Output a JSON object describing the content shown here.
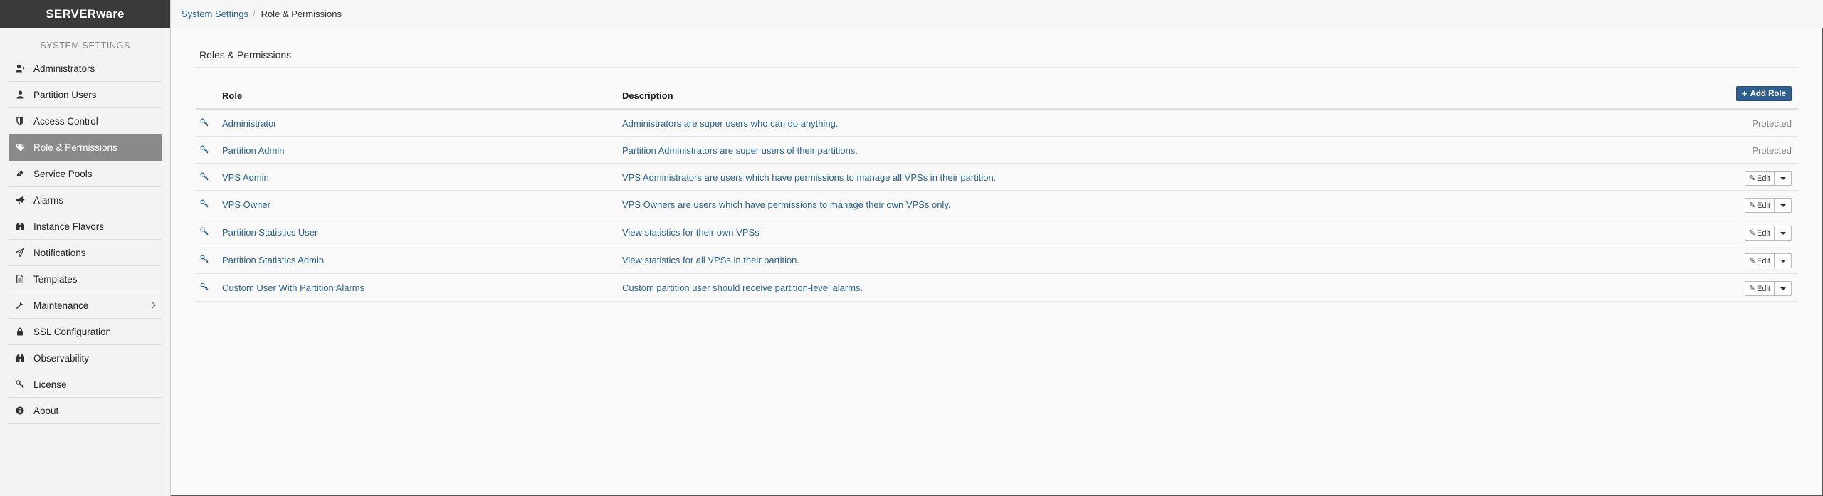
{
  "app": {
    "brand": "SERVERware"
  },
  "sidebar": {
    "section_label": "SYSTEM SETTINGS",
    "items": [
      {
        "label": "Administrators",
        "icon": "user-plus-icon"
      },
      {
        "label": "Partition Users",
        "icon": "user-icon"
      },
      {
        "label": "Access Control",
        "icon": "shield-icon"
      },
      {
        "label": "Role & Permissions",
        "icon": "tags-icon",
        "active": true
      },
      {
        "label": "Service Pools",
        "icon": "pills-icon"
      },
      {
        "label": "Alarms",
        "icon": "bullhorn-icon"
      },
      {
        "label": "Instance Flavors",
        "icon": "binoculars-icon"
      },
      {
        "label": "Notifications",
        "icon": "paper-plane-icon"
      },
      {
        "label": "Templates",
        "icon": "file-text-icon"
      },
      {
        "label": "Maintenance",
        "icon": "wrench-icon",
        "has_submenu": true
      },
      {
        "label": "SSL Configuration",
        "icon": "lock-icon"
      },
      {
        "label": "Observability",
        "icon": "binoculars-icon"
      },
      {
        "label": "License",
        "icon": "key-icon"
      },
      {
        "label": "About",
        "icon": "info-circle-icon"
      }
    ]
  },
  "breadcrumb": {
    "parent": "System Settings",
    "separator": "/",
    "current": "Role & Permissions"
  },
  "main": {
    "title": "Roles & Permissions",
    "add_role_label": "Add Role",
    "columns": {
      "role": "Role",
      "description": "Description"
    },
    "rows": [
      {
        "role": "Administrator",
        "description": "Administrators are super users who can do anything.",
        "status": "Protected"
      },
      {
        "role": "Partition Admin",
        "description": "Partition Administrators are super users of their partitions.",
        "status": "Protected"
      },
      {
        "role": "VPS Admin",
        "description": "VPS Administrators are users which have permissions to manage all VPSs in their partition.",
        "action": "Edit"
      },
      {
        "role": "VPS Owner",
        "description": "VPS Owners are users which have permissions to manage their own VPSs only.",
        "action": "Edit"
      },
      {
        "role": "Partition Statistics User",
        "description": "View statistics for their own VPSs",
        "action": "Edit"
      },
      {
        "role": "Partition Statistics Admin",
        "description": "View statistics for all VPSs in their partition.",
        "action": "Edit"
      },
      {
        "role": "Custom User With Partition Alarms",
        "description": "Custom partition user should receive partition-level alarms.",
        "action": "Edit"
      }
    ]
  },
  "colors": {
    "brand_bg": "#3a3a3a",
    "active_nav_bg": "#8a8a8a",
    "link": "#2a6496",
    "primary_button": "#2f5e8f"
  }
}
